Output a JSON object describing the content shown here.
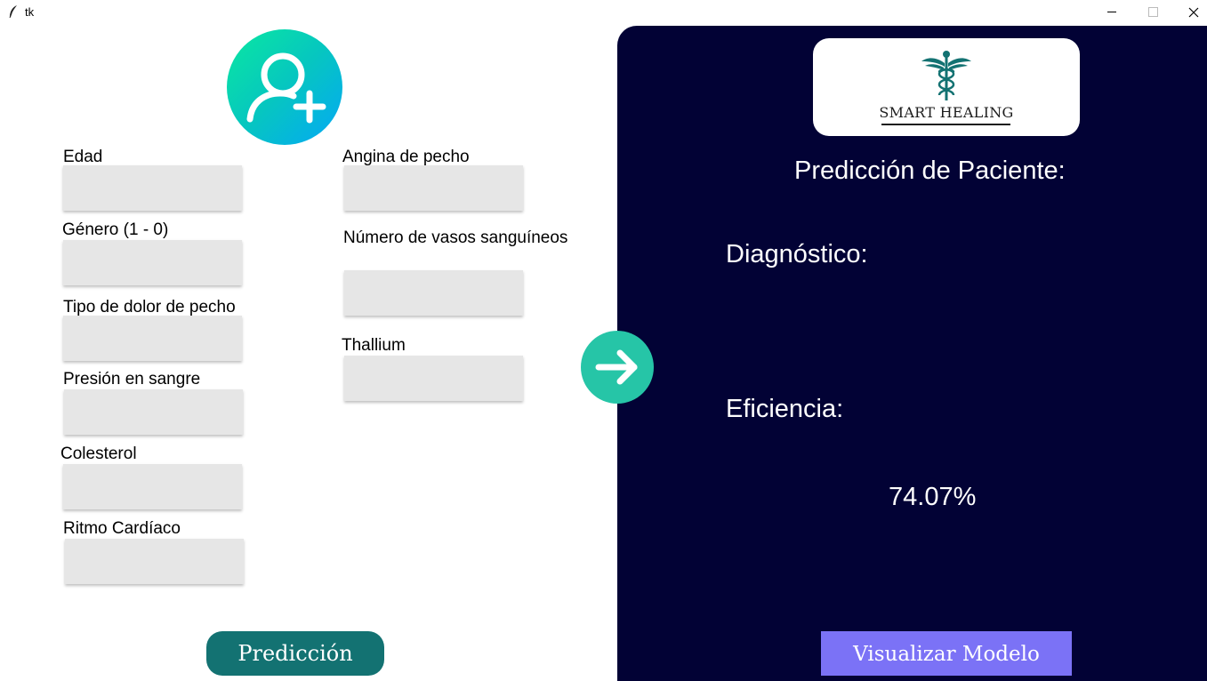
{
  "window": {
    "title": "tk"
  },
  "form": {
    "fields": [
      {
        "label": "Edad",
        "value": ""
      },
      {
        "label": "Género (1 - 0)",
        "value": ""
      },
      {
        "label": "Tipo de dolor de pecho",
        "value": ""
      },
      {
        "label": "Presión en sangre",
        "value": ""
      },
      {
        "label": "Colesterol",
        "value": ""
      },
      {
        "label": "Ritmo Cardíaco",
        "value": ""
      },
      {
        "label": "Angina de pecho",
        "value": ""
      },
      {
        "label": "Número de vasos sanguíneos",
        "value": ""
      },
      {
        "label": "Thallium",
        "value": ""
      }
    ],
    "predict_button": "Predicción"
  },
  "result": {
    "logo_text": "SMART HEALING",
    "title": "Predicción de Paciente:",
    "diagnosis_label": "Diagnóstico:",
    "diagnosis_value": "",
    "efficiency_label": "Eficiencia:",
    "efficiency_value": "74.07%",
    "visualize_button": "Visualizar Modelo"
  },
  "icons": [
    "feather-icon",
    "minimize-icon",
    "maximize-icon",
    "close-icon",
    "add-user-icon",
    "caduceus-icon",
    "arrow-right-icon"
  ],
  "colors": {
    "panel_bg": "#020235",
    "predict_button": "#137272",
    "visualize_button": "#7b72f6",
    "arrow_button": "#26c5a7",
    "field_bg": "#e6e6e6"
  }
}
